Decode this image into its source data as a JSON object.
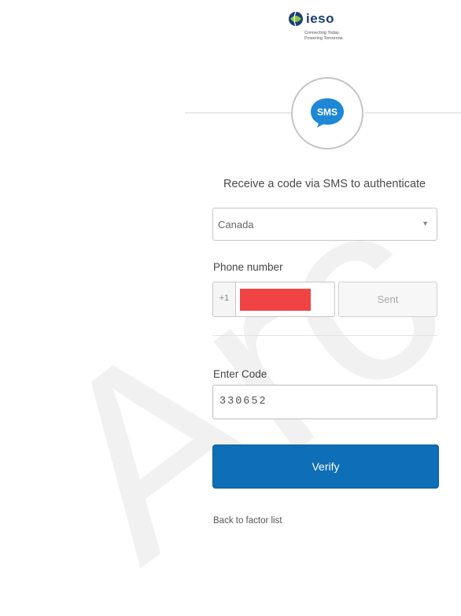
{
  "watermark": {
    "text": "Arc"
  },
  "logo": {
    "brand": "ieso",
    "tagline_line1": "Connecting Today.",
    "tagline_line2": "Powering Tomorrow."
  },
  "factor_icon": {
    "label": "SMS",
    "icon": "sms-chat-bubble-icon",
    "bubble_color": "#1e88d6"
  },
  "headline": "Receive a code via SMS to authenticate",
  "country_select": {
    "selected": "Canada",
    "icon": "caret-down-icon"
  },
  "phone": {
    "label": "Phone number",
    "country_code": "+1",
    "redaction_color": "#f04444",
    "send_button_label": "Sent"
  },
  "code": {
    "label": "Enter Code",
    "value": "330652"
  },
  "verify_button": {
    "label": "Verify",
    "color": "#0e6eb7"
  },
  "back_link": "Back to factor list"
}
